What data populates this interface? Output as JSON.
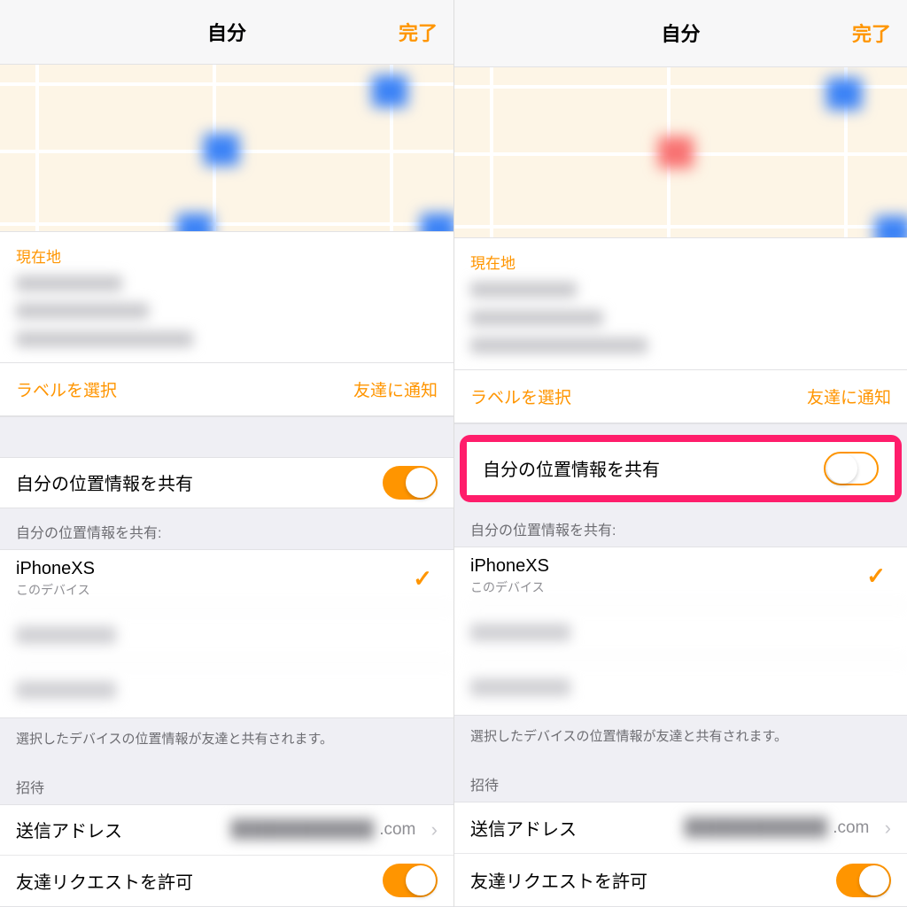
{
  "panes": [
    {
      "nav": {
        "title": "自分",
        "done": "完了"
      },
      "current_location": {
        "label": "現在地"
      },
      "actions": {
        "select_label": "ラベルを選択",
        "notify": "友達に通知"
      },
      "share": {
        "label": "自分の位置情報を共有",
        "on": true,
        "highlighted": false
      },
      "devices_header": "自分の位置情報を共有:",
      "devices": [
        {
          "name": "iPhoneXS",
          "sub": "このデバイス",
          "selected": true,
          "blurred": false
        },
        {
          "name": "████████",
          "sub": "",
          "selected": false,
          "blurred": true
        },
        {
          "name": "████████",
          "sub": "",
          "selected": false,
          "blurred": true
        }
      ],
      "devices_footer": "選択したデバイスの位置情報が友達と共有されます。",
      "invite_header": "招待",
      "send_address": {
        "label": "送信アドレス",
        "value_suffix": ".com"
      },
      "allow_requests": {
        "label": "友達リクエストを許可",
        "on": true
      },
      "dot_color": "#3b82f6"
    },
    {
      "nav": {
        "title": "自分",
        "done": "完了"
      },
      "current_location": {
        "label": "現在地"
      },
      "actions": {
        "select_label": "ラベルを選択",
        "notify": "友達に通知"
      },
      "share": {
        "label": "自分の位置情報を共有",
        "on": false,
        "highlighted": true
      },
      "devices_header": "自分の位置情報を共有:",
      "devices": [
        {
          "name": "iPhoneXS",
          "sub": "このデバイス",
          "selected": true,
          "blurred": false
        },
        {
          "name": "████████",
          "sub": "",
          "selected": false,
          "blurred": true
        },
        {
          "name": "████████",
          "sub": "",
          "selected": false,
          "blurred": true
        }
      ],
      "devices_footer": "選択したデバイスの位置情報が友達と共有されます。",
      "invite_header": "招待",
      "send_address": {
        "label": "送信アドレス",
        "value_suffix": ".com"
      },
      "allow_requests": {
        "label": "友達リクエストを許可",
        "on": true
      },
      "dot_color": "#f87171"
    }
  ]
}
